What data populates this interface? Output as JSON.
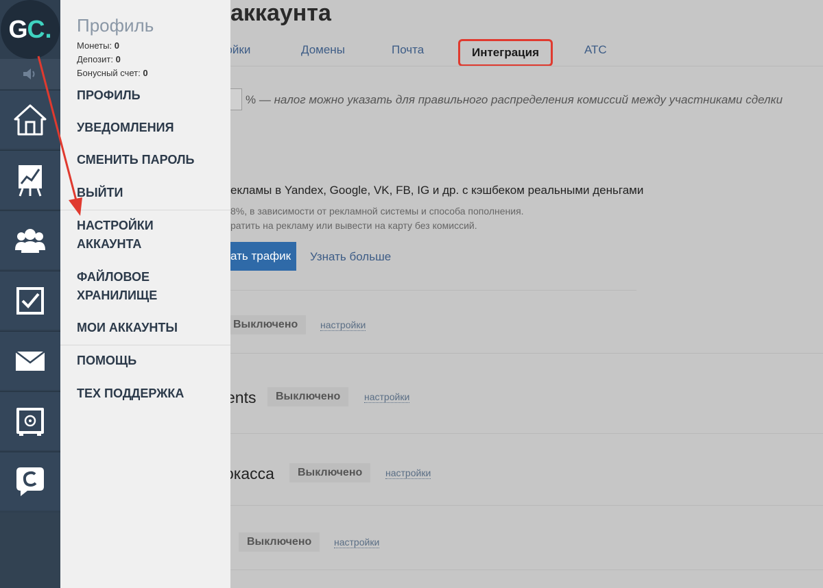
{
  "sidebar": {
    "logo_main": "G",
    "logo_accent": "C.",
    "icons": [
      "home-icon",
      "chart-icon",
      "users-icon",
      "tasks-icon",
      "mail-icon",
      "safe-icon",
      "chat-icon"
    ]
  },
  "menu": {
    "title": "Профиль",
    "stats": [
      {
        "label": "Монеты:",
        "value": "0"
      },
      {
        "label": "Депозит:",
        "value": "0"
      },
      {
        "label": "Бонусный счет:",
        "value": "0"
      }
    ],
    "items": [
      "ПРОФИЛЬ",
      "УВЕДОМЛЕНИЯ",
      "СМЕНИТЬ ПАРОЛЬ",
      "ВЫЙТИ",
      "НАСТРОЙКИ АККАУНТА",
      "ФАЙЛОВОЕ ХРАНИЛИЩЕ",
      "МОИ АККАУНТЫ",
      "ПОМОЩЬ",
      "ТЕХ ПОДДЕРЖКА"
    ]
  },
  "page": {
    "title": "аккаунта",
    "tabs": [
      "ройки",
      "Домены",
      "Почта",
      "Интеграция",
      "АТС"
    ],
    "tax_suffix": "% —",
    "tax_note": "налог можно указать для правильного распределения комиссий между участниками сделки",
    "ad_headline": "екламы в Yandex, Google, VK, FB, IG и др. с кэшбеком реальными деньгами",
    "ad_line1": "8%, в зависимости от рекламной системы и способа пополнения.",
    "ad_line2": "ратить на рекламу или вывести на карту без комиссий.",
    "traffic_button": "ать трафик",
    "learn_more": "Узнать больше",
    "rows": [
      {
        "name": "",
        "status": "Выключено",
        "link": "настройки"
      },
      {
        "name": "ents",
        "status": "Выключено",
        "link": "настройки"
      },
      {
        "name": "окасса",
        "status": "Выключено",
        "link": "настройки"
      },
      {
        "name": "",
        "status": "Выключено",
        "link": "настройки"
      }
    ]
  },
  "colors": {
    "sidebar": "#2f3f50",
    "accent": "#3fd3c0",
    "highlight": "#e03a2f",
    "link": "#3d5c86"
  }
}
